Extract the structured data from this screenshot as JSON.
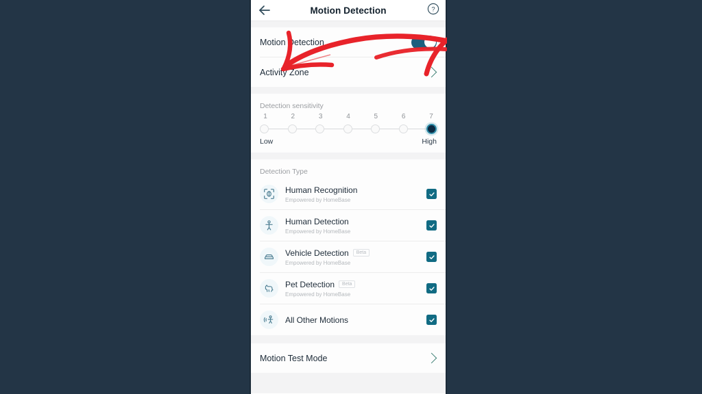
{
  "background_color": "#233546",
  "accent_color": "#116b83",
  "toggle_on_color": "#1d5f7e",
  "annotation_color": "#e8232a",
  "header": {
    "title": "Motion Detection",
    "back_icon": "arrow-left-icon",
    "help_icon": "question-circle-icon"
  },
  "settings": {
    "motion_detection": {
      "label": "Motion Detection",
      "toggle_state": "on"
    },
    "activity_zone": {
      "label": "Activity Zone",
      "chevron_icon": "chevron-right-icon"
    }
  },
  "sensitivity": {
    "title": "Detection sensitivity",
    "steps": [
      "1",
      "2",
      "3",
      "4",
      "5",
      "6",
      "7"
    ],
    "selected": 7,
    "low_label": "Low",
    "high_label": "High"
  },
  "detection_type": {
    "title": "Detection Type",
    "subtitle_text": "Empowered by HomeBase",
    "items": [
      {
        "title": "Human Recognition",
        "subtitle": "Empowered by HomeBase",
        "badge": "",
        "icon": "face-recognition-icon",
        "checked": true
      },
      {
        "title": "Human Detection",
        "subtitle": "Empowered by HomeBase",
        "badge": "",
        "icon": "person-icon",
        "checked": true
      },
      {
        "title": "Vehicle Detection",
        "subtitle": "Empowered by HomeBase",
        "badge": "Beta",
        "icon": "car-icon",
        "checked": true
      },
      {
        "title": "Pet Detection",
        "subtitle": "Empowered by HomeBase",
        "badge": "Beta",
        "icon": "dog-icon",
        "checked": true
      },
      {
        "title": "All Other Motions",
        "subtitle": "",
        "badge": "",
        "icon": "motion-icon",
        "checked": true
      }
    ]
  },
  "motion_test_mode": {
    "label": "Motion Test Mode",
    "chevron_icon": "chevron-right-icon"
  },
  "annotation": {
    "type": "curved-arrow",
    "points_to": "Activity Zone"
  }
}
